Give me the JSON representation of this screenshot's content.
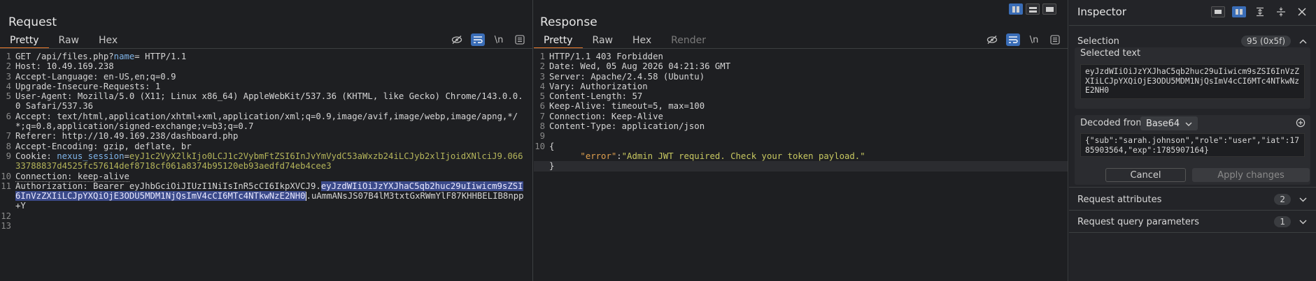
{
  "request": {
    "title": "Request",
    "tabs": [
      "Pretty",
      "Raw",
      "Hex"
    ],
    "active_tab": "Pretty",
    "newline_toggle": "\\n",
    "lines": [
      {
        "n": "1",
        "parts": [
          {
            "t": "GET /api/files.php?",
            "c": ""
          },
          {
            "t": "name",
            "c": "k-blue"
          },
          {
            "t": "= HTTP/1.1",
            "c": ""
          }
        ]
      },
      {
        "n": "2",
        "parts": [
          {
            "t": "Host: 10.49.169.238",
            "c": ""
          }
        ]
      },
      {
        "n": "3",
        "parts": [
          {
            "t": "Accept-Language: en-US,en;q=0.9",
            "c": ""
          }
        ]
      },
      {
        "n": "4",
        "parts": [
          {
            "t": "Upgrade-Insecure-Requests: 1",
            "c": ""
          }
        ]
      },
      {
        "n": "5",
        "parts": [
          {
            "t": "User-Agent: Mozilla/5.0 (X11; Linux x86_64) AppleWebKit/537.36 (KHTML, like Gecko) Chrome/143.0.0.0 Safari/537.36",
            "c": ""
          }
        ]
      },
      {
        "n": "6",
        "parts": [
          {
            "t": "Accept: text/html,application/xhtml+xml,application/xml;q=0.9,image/avif,image/webp,image/apng,*/*;q=0.8,application/signed-exchange;v=b3;q=0.7",
            "c": ""
          }
        ]
      },
      {
        "n": "7",
        "parts": [
          {
            "t": "Referer: http://10.49.169.238/dashboard.php",
            "c": ""
          }
        ]
      },
      {
        "n": "8",
        "parts": [
          {
            "t": "Accept-Encoding: gzip, deflate, br",
            "c": ""
          }
        ]
      },
      {
        "n": "9",
        "parts": [
          {
            "t": "Cookie: ",
            "c": ""
          },
          {
            "t": "nexus_session",
            "c": "k-blue"
          },
          {
            "t": "=",
            "c": ""
          },
          {
            "t": "eyJ1c2VyX2lkIjo0LCJ1c2VybmFtZSI6InJvYmVydC53aWxzb24iLCJyb2xlIjoidXNlciJ9.06633788837d4525fc57614def8718cf061a8374b95120eb93aedfd74eb4cee3",
            "c": "k-green"
          }
        ]
      },
      {
        "n": "10",
        "parts": [
          {
            "t": "Connection: keep-alive",
            "c": "dotted"
          }
        ]
      },
      {
        "n": "11",
        "parts": [
          {
            "t": "Authorization: Bearer eyJhbGciOiJIUzI1NiIsInR5cCI6IkpXVCJ9.",
            "c": ""
          },
          {
            "t": "eyJzdWIiOiJzYXJhaC5qb2huc29uIiwicm9sZSI6InVzZXIiLCJpYXQiOjE3ODU5MDM1NjQsImV4cCI6MTc4NTkwNzE2NH0",
            "c": "hl"
          },
          {
            "t": ".uAmmANsJS07B4lM3txtGxRWmYlF87KHHBELIB8npp+Y",
            "c": ""
          }
        ]
      },
      {
        "n": "12",
        "parts": [
          {
            "t": "",
            "c": ""
          }
        ]
      },
      {
        "n": "13",
        "parts": [
          {
            "t": "",
            "c": ""
          }
        ]
      }
    ]
  },
  "response": {
    "title": "Response",
    "tabs": [
      "Pretty",
      "Raw",
      "Hex",
      "Render"
    ],
    "active_tab": "Pretty",
    "newline_toggle": "\\n",
    "lines": [
      {
        "n": "1",
        "parts": [
          {
            "t": "HTTP/1.1 403 Forbidden",
            "c": ""
          }
        ]
      },
      {
        "n": "2",
        "parts": [
          {
            "t": "Date: Wed, 05 Aug 2026 04:21:36 GMT",
            "c": ""
          }
        ]
      },
      {
        "n": "3",
        "parts": [
          {
            "t": "Server: Apache/2.4.58 (Ubuntu)",
            "c": ""
          }
        ]
      },
      {
        "n": "4",
        "parts": [
          {
            "t": "Vary: Authorization",
            "c": ""
          }
        ]
      },
      {
        "n": "5",
        "parts": [
          {
            "t": "Content-Length: 57",
            "c": ""
          }
        ]
      },
      {
        "n": "6",
        "parts": [
          {
            "t": "Keep-Alive: timeout=5, max=100",
            "c": ""
          }
        ]
      },
      {
        "n": "7",
        "parts": [
          {
            "t": "Connection: Keep-Alive",
            "c": ""
          }
        ]
      },
      {
        "n": "8",
        "parts": [
          {
            "t": "Content-Type: application/json",
            "c": ""
          }
        ]
      },
      {
        "n": "9",
        "parts": [
          {
            "t": "",
            "c": ""
          }
        ]
      },
      {
        "n": "10",
        "parts": [
          {
            "t": "{",
            "c": ""
          }
        ]
      },
      {
        "n": "",
        "parts": [
          {
            "t": "      \"error\"",
            "c": "k-orange"
          },
          {
            "t": ":",
            "c": ""
          },
          {
            "t": "\"Admin JWT required. Check your token payload.\"",
            "c": "k-json-val"
          }
        ]
      },
      {
        "n": "",
        "parts": [
          {
            "t": "}",
            "c": ""
          }
        ],
        "sel": true
      }
    ]
  },
  "inspector": {
    "title": "Inspector",
    "selection_label": "Selection",
    "selection_count": "95 (0x5f)",
    "selected_text_label": "Selected text",
    "selected_text": "eyJzdWIiOiJzYXJhaC5qb2huc29uIiwicm9sZSI6InVzZXIiLCJpYXQiOjE3ODU5MDM1NjQsImV4cCI6MTc4NTkwNzE2NH0",
    "decoded_from_label": "Decoded from:",
    "decoded_from_value": "Base64",
    "decoded_text": "{\"sub\":\"sarah.johnson\",\"role\":\"user\",\"iat\":1785903564,\"exp\":1785907164}",
    "cancel_label": "Cancel",
    "apply_label": "Apply changes",
    "request_attributes_label": "Request attributes",
    "request_attributes_count": "2",
    "request_query_label": "Request query parameters",
    "request_query_count": "1"
  },
  "colors": {
    "accent_orange": "#e8782c",
    "toggle_blue": "#3a6db7",
    "selection_highlight": "#3b4a8a"
  }
}
